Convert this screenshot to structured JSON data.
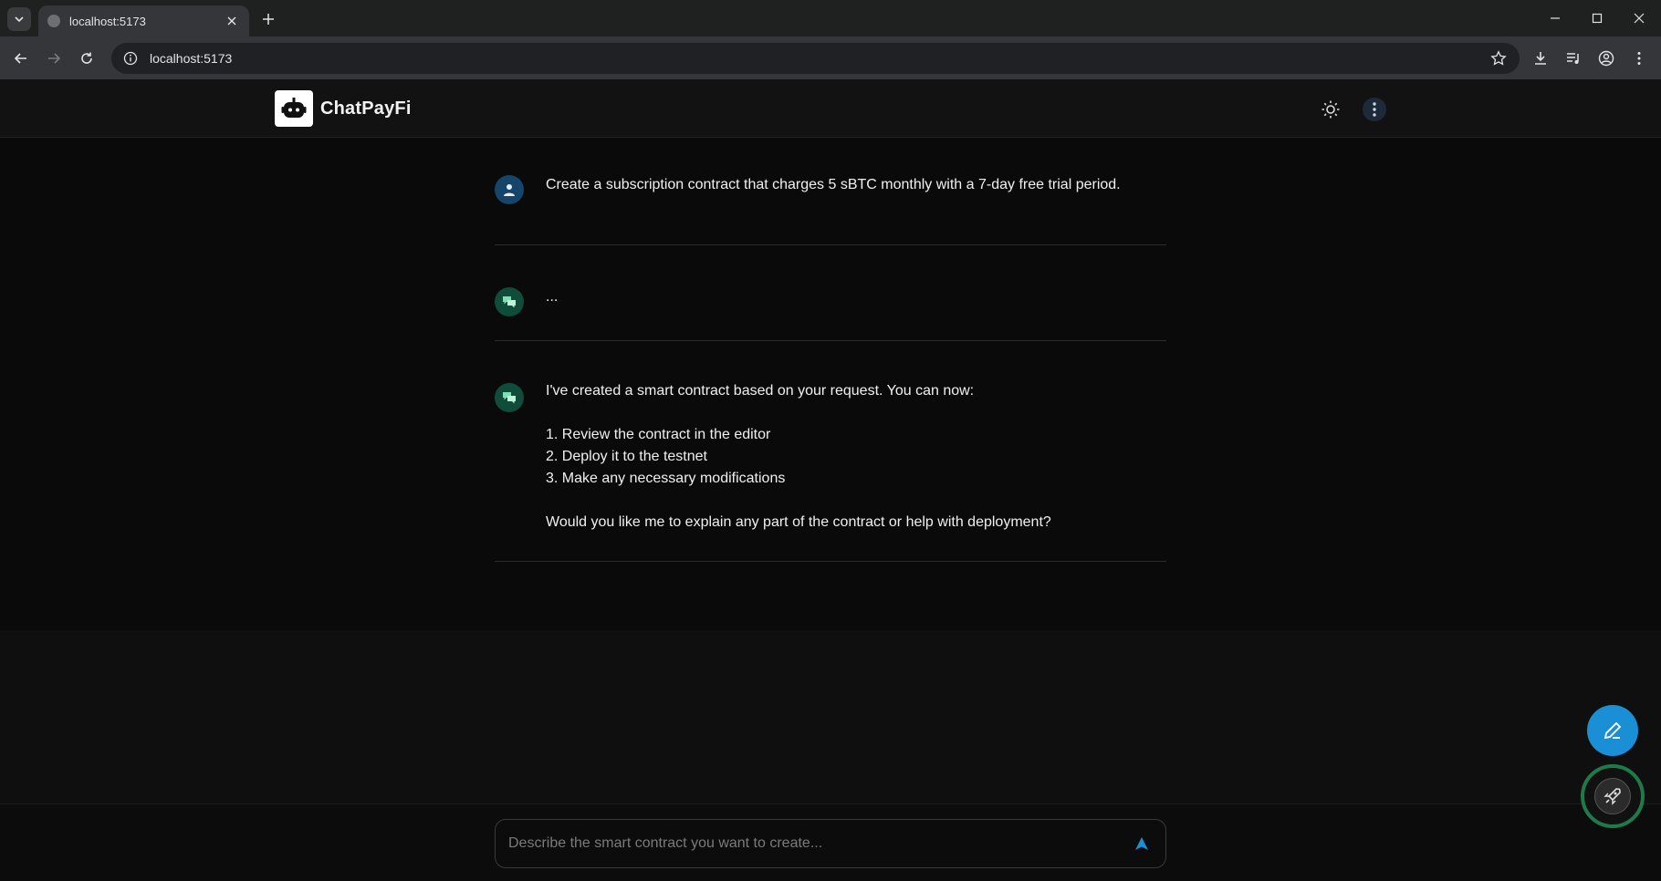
{
  "browser": {
    "tab_title": "localhost:5173",
    "url": "localhost:5173"
  },
  "app": {
    "brand_name": "ChatPayFi"
  },
  "messages": [
    {
      "role": "user",
      "text": "Create a subscription contract that charges 5 sBTC monthly with a 7-day free trial period."
    },
    {
      "role": "assistant",
      "text": "..."
    },
    {
      "role": "assistant",
      "intro": "I've created a smart contract based on your request. You can now:",
      "steps": [
        "1. Review the contract in the editor",
        "2. Deploy it to the testnet",
        "3. Make any necessary modifications"
      ],
      "outro": "Would you like me to explain any part of the contract or help with deployment?"
    }
  ],
  "composer": {
    "placeholder": "Describe the smart contract you want to create..."
  },
  "colors": {
    "accent_blue": "#1a8fd6",
    "user_avatar": "#15456b",
    "bot_avatar": "#0f4d3a",
    "fab_ring": "#1f7a4a"
  }
}
